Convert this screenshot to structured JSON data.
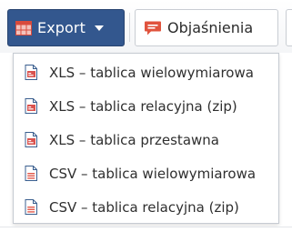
{
  "toolbar": {
    "export_label": "Export",
    "export_icon": "table-export-icon",
    "explanations_label": "Objaśnienia",
    "explanations_icon": "speech-bubble-icon"
  },
  "export_menu": {
    "items": [
      {
        "label": "XLS – tablica wielowymiarowa",
        "icon": "xls-file-icon"
      },
      {
        "label": "XLS – tablica relacyjna (zip)",
        "icon": "xls-file-icon"
      },
      {
        "label": "XLS – tablica przestawna",
        "icon": "xls-file-icon"
      },
      {
        "label": "CSV – tablica wielowymiarowa",
        "icon": "csv-file-icon"
      },
      {
        "label": "CSV – tablica relacyjna (zip)",
        "icon": "csv-file-icon"
      }
    ]
  },
  "colors": {
    "export_button_bg": "#33578e",
    "xls_icon": "#d9534f",
    "csv_icon": "#e2584a",
    "file_icon_border": "#3b5f8f",
    "speech_icon": "#e0533d"
  }
}
